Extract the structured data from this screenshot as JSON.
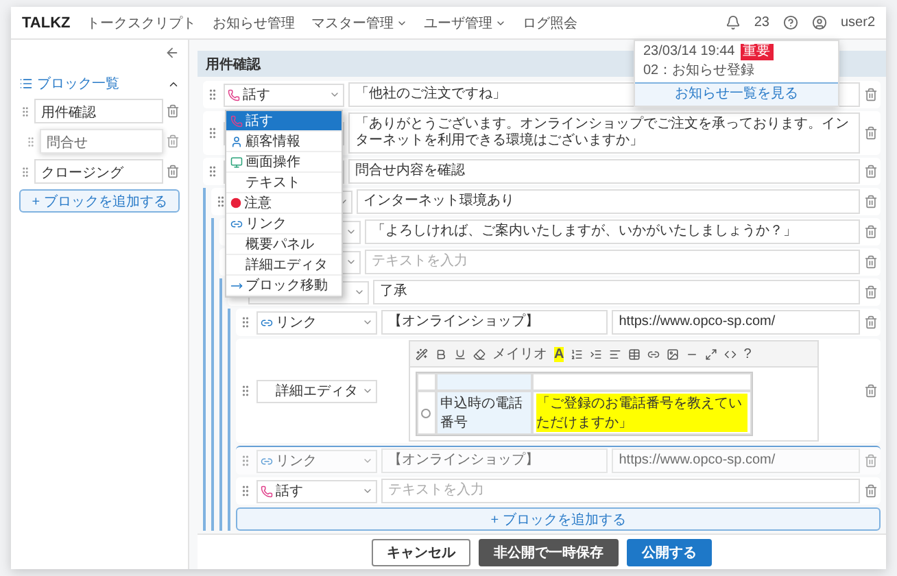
{
  "header": {
    "logo": "TALKZ",
    "nav": [
      {
        "label": "トークスクリプト",
        "dropdown": false
      },
      {
        "label": "お知らせ管理",
        "dropdown": false
      },
      {
        "label": "マスター管理",
        "dropdown": true
      },
      {
        "label": "ユーザ管理",
        "dropdown": true
      },
      {
        "label": "ログ照会",
        "dropdown": false
      }
    ],
    "notifications": "23",
    "user": "user2"
  },
  "notification_popup": {
    "time": "23/03/14 19:44",
    "badge": "重要",
    "text": "02：お知らせ登録",
    "link": "お知らせ一覧を見る"
  },
  "sidebar": {
    "title": "ブロック一覧",
    "expanded": true,
    "items": [
      {
        "label": "用件確認",
        "dragging": false
      },
      {
        "label": "問合せ",
        "dragging": true
      },
      {
        "label": "クロージング",
        "dragging": false
      }
    ],
    "add_button": "+ ブロックを追加する"
  },
  "main": {
    "title": "用件確認",
    "rows": [
      {
        "kind": "talk",
        "type_label": "話す",
        "value": "「他社のご注文ですね」"
      },
      {
        "kind": "plain",
        "value": "「ありがとうございます。オンラインショップでご注文を承っております。インターネットを利用できる環境はございますか」"
      },
      {
        "kind": "plain",
        "value": "問合せ内容を確認"
      },
      {
        "kind": "plain",
        "value": "インターネット環境あり",
        "children": [
          {
            "value": "「よろしければ、ご案内いたしますが、いかがいたしましょうか？」"
          },
          {
            "placeholder": "テキストを入力"
          },
          {
            "value": "了承",
            "children": [
              {
                "kind": "link",
                "type_label": "リンク",
                "value": "【オンラインショップ】",
                "url": "https://www.opco-sp.com/",
                "dragging": false
              },
              {
                "kind": "editor",
                "type_label": "詳細エディタ",
                "toolbar": {
                  "font": "メイリオ",
                  "color_label": "A",
                  "help": "?"
                },
                "table": [
                  {
                    "kind": "header"
                  },
                  {
                    "kind": "option",
                    "checked": false,
                    "label": "申込時の電話番号",
                    "value": "「ご登録のお電話番号を教えていただけますか」"
                  }
                ]
              },
              {
                "kind": "link",
                "type_label": "リンク",
                "value": "【オンラインショップ】",
                "url": "https://www.opco-sp.com/",
                "dragging": true
              },
              {
                "kind": "talk",
                "type_label": "話す",
                "placeholder": "テキストを入力"
              }
            ],
            "add_button": "+ ブロックを追加する"
          }
        ]
      }
    ],
    "type_menu": {
      "items": [
        {
          "kind": "talk",
          "label": "話す",
          "selected": true
        },
        {
          "kind": "person",
          "label": "顧客情報",
          "selected": false
        },
        {
          "kind": "screen",
          "label": "画面操作",
          "selected": false
        },
        {
          "kind": "none",
          "label": "テキスト",
          "selected": false
        },
        {
          "kind": "alert",
          "label": "注意",
          "selected": false
        },
        {
          "kind": "link",
          "label": "リンク",
          "selected": false
        },
        {
          "kind": "none",
          "label": "概要パネル",
          "selected": false
        },
        {
          "kind": "none",
          "label": "詳細エディタ",
          "selected": false
        },
        {
          "kind": "move",
          "label": "ブロック移動",
          "selected": false
        }
      ]
    }
  },
  "footer": {
    "buttons": [
      {
        "label": "キャンセル",
        "kind": "outline"
      },
      {
        "label": "非公開で一時保存",
        "kind": "dark"
      },
      {
        "label": "公開する",
        "kind": "primary"
      }
    ]
  }
}
